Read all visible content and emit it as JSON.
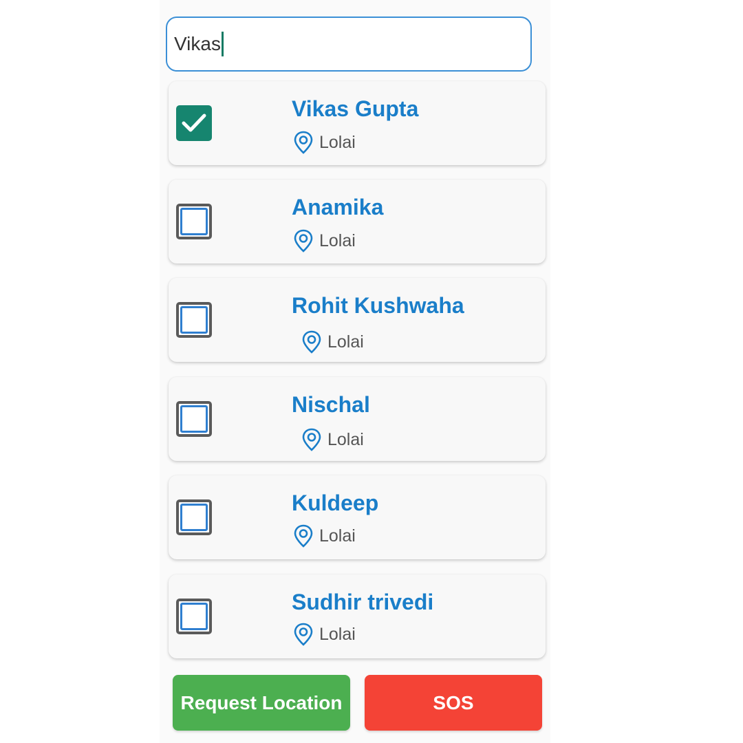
{
  "search": {
    "value": "Vikas"
  },
  "contacts": [
    {
      "name": "Vikas Gupta",
      "location": "Lolai",
      "checked": true
    },
    {
      "name": "Anamika",
      "location": "Lolai",
      "checked": false
    },
    {
      "name": "Rohit Kushwaha",
      "location": "Lolai",
      "checked": false
    },
    {
      "name": "Nischal",
      "location": "Lolai",
      "checked": false
    },
    {
      "name": "Kuldeep",
      "location": "Lolai",
      "checked": false
    },
    {
      "name": "Sudhir trivedi",
      "location": "Lolai",
      "checked": false
    }
  ],
  "actions": {
    "request_location_label": "Request Location",
    "sos_label": "SOS"
  },
  "colors": {
    "accent": "#1a7ec9",
    "checked": "#16856f",
    "request_button": "#4caf50",
    "sos_button": "#f44336"
  },
  "icons": {
    "location": "location-pin-icon",
    "check": "checkmark-icon"
  }
}
